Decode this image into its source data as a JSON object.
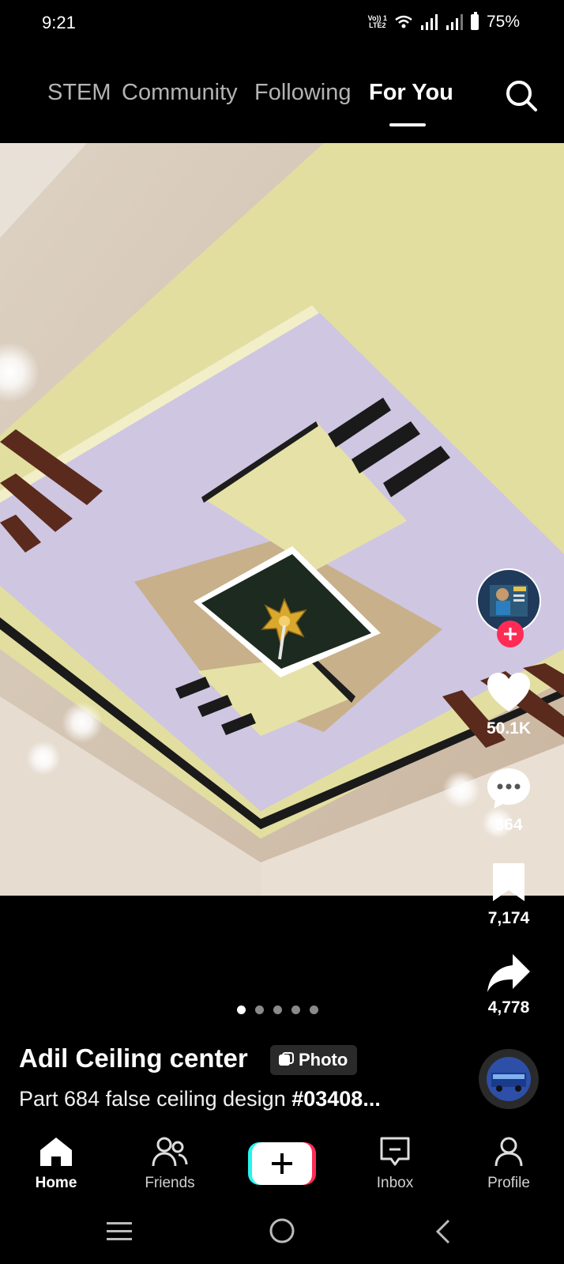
{
  "status_bar": {
    "time": "9:21",
    "network_line1": "Vo)) 1",
    "network_line2": "LTE2",
    "battery": "75%"
  },
  "top_tabs": {
    "items": [
      "STEM",
      "Community",
      "Following",
      "For You"
    ],
    "active": "For You"
  },
  "post": {
    "author": "Adil Ceiling center",
    "type_badge": "Photo",
    "caption_text": "Part 684 false ceiling design ",
    "caption_tag": "#03408...",
    "slide_count": 5,
    "active_slide": 1
  },
  "actions": {
    "likes": "50.1K",
    "comments": "364",
    "saves": "7,174",
    "shares": "4,778"
  },
  "bottom_nav": {
    "home": "Home",
    "friends": "Friends",
    "inbox": "Inbox",
    "profile": "Profile"
  },
  "colors": {
    "like_red": "#fe2c55",
    "create_cyan": "#25f4ee",
    "create_pink": "#fe2c55"
  },
  "icons": [
    "search-icon",
    "heart-icon",
    "comment-icon",
    "bookmark-icon",
    "share-icon",
    "home-icon",
    "friends-icon",
    "plus-icon",
    "inbox-icon",
    "profile-icon"
  ]
}
